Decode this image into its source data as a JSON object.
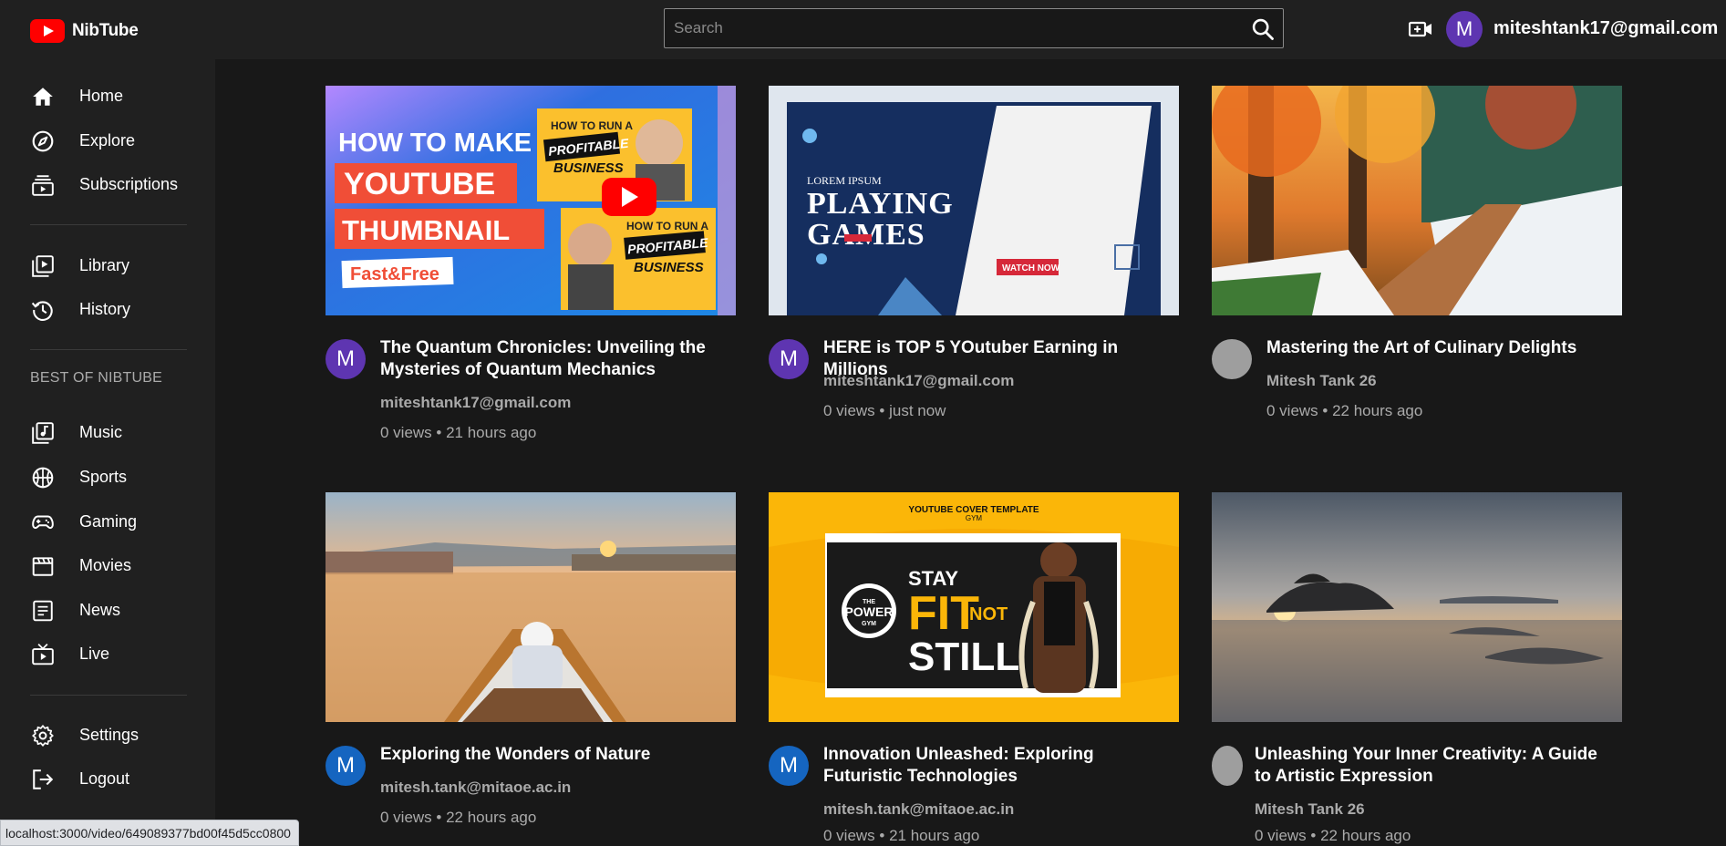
{
  "header": {
    "app_name": "NibTube",
    "search_placeholder": "Search",
    "user_initial": "M",
    "user_email": "miteshtank17@gmail.com",
    "icons": [
      "search-icon",
      "video-upload-icon"
    ]
  },
  "sidebar": {
    "primary": [
      {
        "label": "Home",
        "icon": "home-icon"
      },
      {
        "label": "Explore",
        "icon": "compass-icon"
      },
      {
        "label": "Subscriptions",
        "icon": "subscriptions-icon"
      }
    ],
    "secondary": [
      {
        "label": "Library",
        "icon": "library-icon"
      },
      {
        "label": "History",
        "icon": "history-icon"
      }
    ],
    "section_title": "BEST OF NIBTUBE",
    "best_of": [
      {
        "label": "Music",
        "icon": "music-icon"
      },
      {
        "label": "Sports",
        "icon": "basketball-icon"
      },
      {
        "label": "Gaming",
        "icon": "gamepad-icon"
      },
      {
        "label": "Movies",
        "icon": "clapperboard-icon"
      },
      {
        "label": "News",
        "icon": "newspaper-icon"
      },
      {
        "label": "Live",
        "icon": "live-tv-icon"
      }
    ],
    "bottom": [
      {
        "label": "Settings",
        "icon": "gear-icon"
      },
      {
        "label": "Logout",
        "icon": "logout-icon"
      }
    ]
  },
  "videos": [
    {
      "title": "The Quantum Chronicles: Unveiling the Mysteries of Quantum Mechanics",
      "channel": "miteshtank17@gmail.com",
      "meta": "0 views • 21 hours ago",
      "avatar_initial": "M",
      "avatar_color": "#5e35b1",
      "thumbnail_text": [
        "HOW TO MAKE AN",
        "YOUTUBE",
        "THUMBNAIL",
        "Fast&Free",
        "HOW TO RUN A",
        "PROFITABLE",
        "BUSINESS",
        "HOW TO RUN A",
        "PROFITABLE",
        "BUSINESS"
      ]
    },
    {
      "title": "HERE is TOP 5 YOutuber Earning in Millions",
      "channel": "miteshtank17@gmail.com",
      "meta": "0 views • just now",
      "avatar_initial": "M",
      "avatar_color": "#5e35b1",
      "thumbnail_text": [
        "LOREM IPSUM",
        "PLAYING",
        "GAMES",
        "WATCH NOW"
      ]
    },
    {
      "title": "Mastering the Art of Culinary Delights",
      "channel": "Mitesh Tank 26",
      "meta": "0 views • 22 hours ago",
      "avatar_initial": "",
      "avatar_color": "#9e9e9e",
      "thumbnail_text": []
    },
    {
      "title": "Exploring the Wonders of Nature",
      "channel": "mitesh.tank@mitaoe.ac.in",
      "meta": "0 views • 22 hours ago",
      "avatar_initial": "M",
      "avatar_color": "#1565c0",
      "thumbnail_text": []
    },
    {
      "title": "Innovation Unleashed: Exploring Futuristic Technologies",
      "channel": "mitesh.tank@mitaoe.ac.in",
      "meta": "0 views • 21 hours ago",
      "avatar_initial": "M",
      "avatar_color": "#1565c0",
      "thumbnail_text": [
        "YOUTUBE COVER TEMPLATE",
        "GYM",
        "STAY",
        "FIT",
        "NOT",
        "STILL",
        "THE",
        "POWER",
        "GYM"
      ]
    },
    {
      "title": "Unleashing Your Inner Creativity: A Guide to Artistic Expression",
      "channel": "Mitesh Tank 26",
      "meta": "0 views • 22 hours ago",
      "avatar_initial": "",
      "avatar_color": "#9e9e9e",
      "thumbnail_text": []
    }
  ],
  "status_bar_url": "localhost:3000/video/649089377bd00f45d5cc0800",
  "colors": {
    "background": "#181818",
    "surface": "#202020",
    "brand_red": "#ff0000",
    "avatar_purple": "#5e35b1",
    "avatar_blue": "#1565c0"
  }
}
